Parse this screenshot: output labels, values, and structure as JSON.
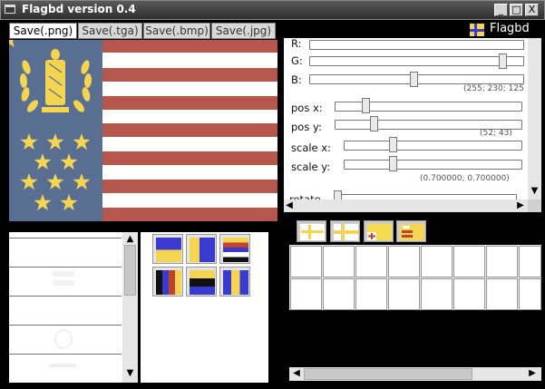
{
  "window": {
    "title": "Flagbd version 0.4",
    "controls": [
      "_",
      "□",
      "X"
    ]
  },
  "tabs": [
    {
      "label": "Save(.png)",
      "active": true
    },
    {
      "label": "Save(.tga)",
      "active": false
    },
    {
      "label": "Save(.bmp)",
      "active": false
    },
    {
      "label": "Save(.jpg)",
      "active": false
    }
  ],
  "brand": {
    "label": "Flagbd"
  },
  "flag": {
    "canton_color": "#586f92",
    "stripe_red": "#b5574c",
    "stripe_white": "#ffffff",
    "emblem_color": "#f5d451"
  },
  "controls_panel": {
    "r_label": "R:",
    "g_label": "G:",
    "b_label": "B:",
    "rgb_value": "(255; 230; 125",
    "pos_x_label": "pos  x:",
    "pos_y_label": "pos  y:",
    "pos_value": "(52; 43)",
    "scale_x_label": "scale x:",
    "scale_y_label": "scale y:",
    "scale_value": "(0.700000; 0.700000)",
    "rotate_label": "rotate"
  }
}
